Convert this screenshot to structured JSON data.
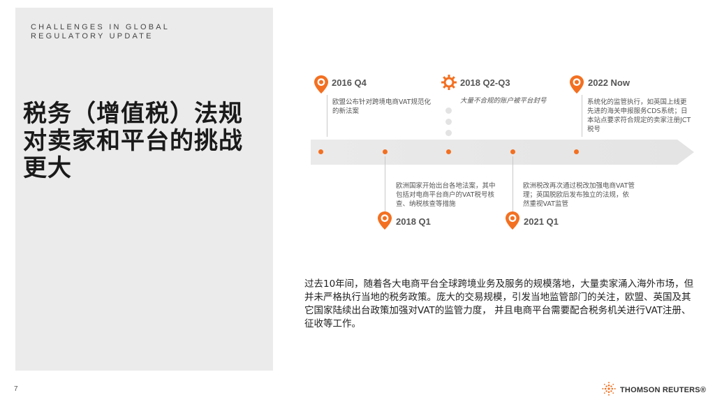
{
  "header": {
    "eyebrow": "CHALLENGES IN GLOBAL\nREGULATORY UPDATE",
    "title": "税务（增值税）法规对卖家和平台的挑战更大"
  },
  "timeline": {
    "events": [
      {
        "label": "2016 Q4",
        "text": "欧盟公布针对跨境电商VAT规范化的新法案"
      },
      {
        "label": "2018 Q1",
        "text": "欧洲国家开始出台各地法案，其中包括对电商平台商户的VAT税号核查、纳税核查等措施"
      },
      {
        "label": "2018 Q2-Q3",
        "text": "大量不合规的账户被平台封号"
      },
      {
        "label": "2021 Q1",
        "text": "欧洲税改再次通过税改加强电商VAT管理；英国脱欧后发布独立的法规，依然重视VAT监管"
      },
      {
        "label": "2022 Now",
        "text": "系统化的监管执行，如英国上线更先进的海关申报服务CDS系统；日本站点要求符合规定的卖家注册JCT税号"
      }
    ]
  },
  "summary": "过去10年间，随着各大电商平台全球跨境业务及服务的规模落地，大量卖家涌入海外市场，但并未严格执行当地的税务政策。庞大的交易规模，引发当地监管部门的关注，欧盟、英国及其它国家陆续出台政策加强对VAT的监管力度， 并且电商平台需要配合税务机关进行VAT注册、征收等工作。",
  "footer": {
    "page_number": "7",
    "brand": "THOMSON REUTERS®"
  },
  "colors": {
    "accent": "#f37021",
    "panel": "#ebebeb"
  },
  "icons": {
    "pin": "map-pin-icon",
    "gear": "gear-icon",
    "logo": "thomson-reuters-logo-icon"
  }
}
